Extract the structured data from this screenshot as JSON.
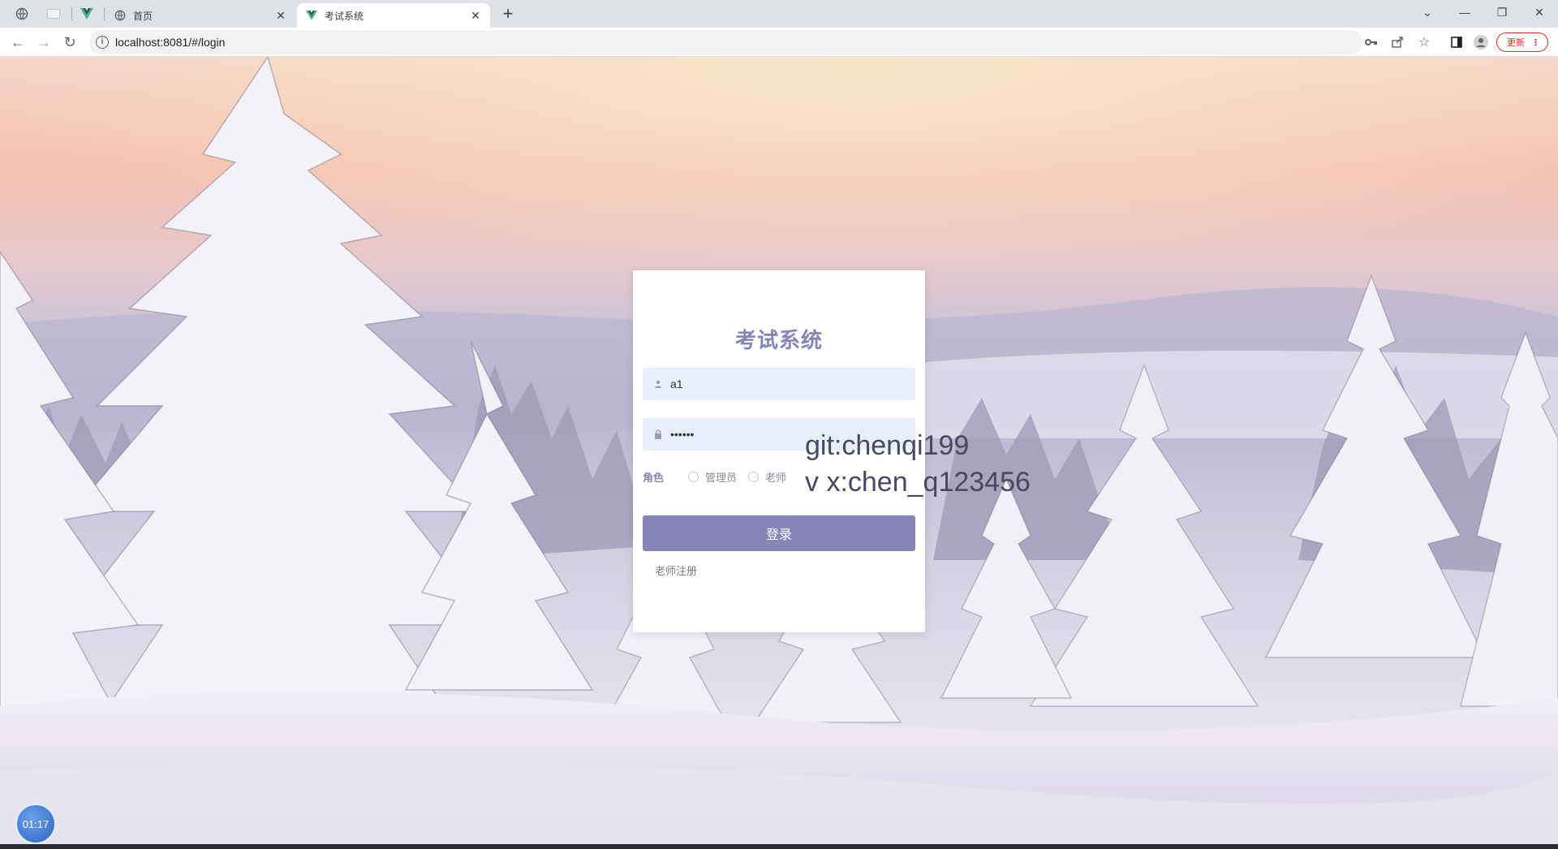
{
  "browser": {
    "tabs": [
      {
        "title": "首页",
        "active": false
      },
      {
        "title": "考试系统",
        "active": true
      }
    ],
    "address_bar": {
      "url": "localhost:8081/#/login"
    },
    "update_button": "更新"
  },
  "login": {
    "title": "考试系统",
    "username_value": "a1",
    "password_value": "••••••",
    "role_label": "角色",
    "roles": [
      "管理员",
      "老师"
    ],
    "submit_label": "登录",
    "register_link": "老师注册"
  },
  "watermark": {
    "line1": "git:chenqi199",
    "line2": "v x:chen_q123456"
  },
  "recorder": {
    "timer": "01:17"
  },
  "colors": {
    "accent": "#8785b8",
    "field_bg": "#e8f0fe"
  }
}
